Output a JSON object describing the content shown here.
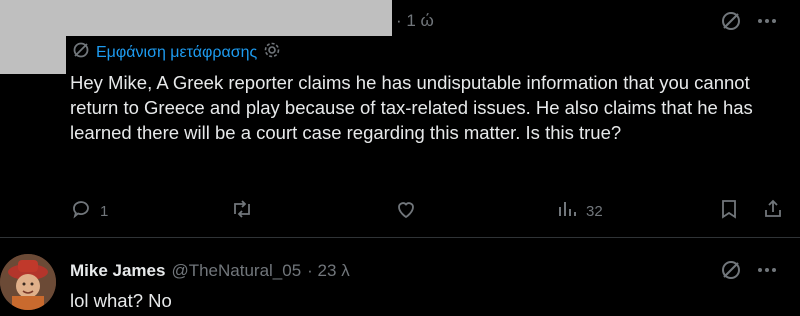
{
  "tweet": {
    "timestamp": "· 1 ώ",
    "translation_label": "Εμφάνιση μετάφρασης",
    "text": "Hey Mike, A Greek reporter claims he has undisputable information that you cannot return to Greece and play because of tax-related issues. He also claims that he has learned there will be a court case regarding this matter. Is this true?",
    "reply_count": "1",
    "views_count": "32"
  },
  "reply": {
    "name": "Mike James",
    "handle": "@TheNatural_05",
    "timestamp": "· 23 λ",
    "text": "lol what? No"
  },
  "colors": {
    "accent": "#1d9bf0",
    "muted": "#71767b",
    "text": "#e7e9ea",
    "background": "#000000"
  },
  "icons": {
    "grok": "grok-icon",
    "more": "more-icon",
    "gear": "gear-icon",
    "reply": "reply-icon",
    "retweet": "retweet-icon",
    "like": "like-icon",
    "views": "views-icon",
    "bookmark": "bookmark-icon",
    "share": "share-icon"
  }
}
